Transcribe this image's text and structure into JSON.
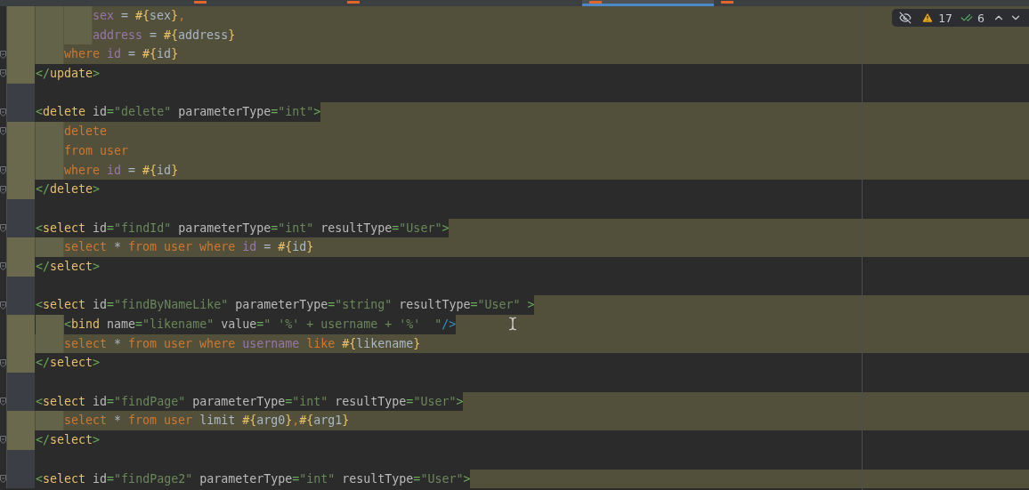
{
  "tabs": [
    {
      "selected": false
    },
    {
      "selected": false
    },
    {
      "selected": true
    },
    {
      "selected": false
    }
  ],
  "inspections": {
    "warnings": "17",
    "weak_warnings": "6"
  },
  "lines": [
    {
      "kind": "full",
      "gutter_marked": true,
      "fold_marker": false,
      "tokens": [
        {
          "kind": "ident",
          "text": "        sex"
        },
        {
          "kind": "text",
          "text": " = "
        },
        {
          "kind": "expr",
          "text": "#{"
        },
        {
          "kind": "text",
          "text": "sex"
        },
        {
          "kind": "expr",
          "text": "}"
        },
        {
          "kind": "kw",
          "text": ","
        }
      ]
    },
    {
      "kind": "full",
      "gutter_marked": true,
      "fold_marker": false,
      "tokens": [
        {
          "kind": "ident",
          "text": "        address"
        },
        {
          "kind": "text",
          "text": " = "
        },
        {
          "kind": "expr",
          "text": "#{"
        },
        {
          "kind": "text",
          "text": "address"
        },
        {
          "kind": "expr",
          "text": "}"
        }
      ]
    },
    {
      "kind": "full",
      "gutter_marked": true,
      "fold_marker": true,
      "tokens": [
        {
          "kind": "kw",
          "text": "    where "
        },
        {
          "kind": "ident",
          "text": "id"
        },
        {
          "kind": "text",
          "text": " = "
        },
        {
          "kind": "expr",
          "text": "#{"
        },
        {
          "kind": "text",
          "text": "id"
        },
        {
          "kind": "expr",
          "text": "}"
        }
      ]
    },
    {
      "kind": "plain",
      "gutter_marked": true,
      "fold_marker": true,
      "tokens": [
        {
          "kind": "bracket",
          "text": "</"
        },
        {
          "kind": "tag",
          "text": "update"
        },
        {
          "kind": "bracket",
          "text": ">"
        }
      ]
    },
    {
      "kind": "plain",
      "gutter_marked": false,
      "fold_marker": false
    },
    {
      "kind": "tail",
      "gutter_marked": false,
      "fold_marker": true,
      "tokens": [
        {
          "kind": "bracket",
          "text": "<"
        },
        {
          "kind": "tag",
          "text": "delete"
        },
        {
          "kind": "attr",
          "text": " id"
        },
        {
          "kind": "eq",
          "text": "="
        },
        {
          "kind": "str",
          "text": "\"delete\""
        },
        {
          "kind": "attr",
          "text": " parameterType"
        },
        {
          "kind": "eq",
          "text": "="
        },
        {
          "kind": "str",
          "text": "\"int\""
        },
        {
          "kind": "bracket",
          "text": ">"
        }
      ]
    },
    {
      "kind": "full",
      "gutter_marked": true,
      "fold_marker": true,
      "tokens": [
        {
          "kind": "kw",
          "text": "    delete"
        }
      ]
    },
    {
      "kind": "full",
      "gutter_marked": true,
      "fold_marker": false,
      "tokens": [
        {
          "kind": "kw",
          "text": "    from user"
        }
      ]
    },
    {
      "kind": "full",
      "gutter_marked": true,
      "fold_marker": true,
      "tokens": [
        {
          "kind": "kw",
          "text": "    where "
        },
        {
          "kind": "ident",
          "text": "id"
        },
        {
          "kind": "text",
          "text": " = "
        },
        {
          "kind": "expr",
          "text": "#{"
        },
        {
          "kind": "text",
          "text": "id"
        },
        {
          "kind": "expr",
          "text": "}"
        }
      ]
    },
    {
      "kind": "plain",
      "gutter_marked": true,
      "fold_marker": true,
      "tokens": [
        {
          "kind": "bracket",
          "text": "</"
        },
        {
          "kind": "tag",
          "text": "delete"
        },
        {
          "kind": "bracket",
          "text": ">"
        }
      ]
    },
    {
      "kind": "plain",
      "gutter_marked": false,
      "fold_marker": false
    },
    {
      "kind": "tail",
      "gutter_marked": false,
      "fold_marker": true,
      "tokens": [
        {
          "kind": "bracket",
          "text": "<"
        },
        {
          "kind": "tag",
          "text": "select"
        },
        {
          "kind": "attr",
          "text": " id"
        },
        {
          "kind": "eq",
          "text": "="
        },
        {
          "kind": "str",
          "text": "\"findId\""
        },
        {
          "kind": "attr",
          "text": " parameterType"
        },
        {
          "kind": "eq",
          "text": "="
        },
        {
          "kind": "str",
          "text": "\"int\""
        },
        {
          "kind": "attr",
          "text": " resultType"
        },
        {
          "kind": "eq",
          "text": "="
        },
        {
          "kind": "str",
          "text": "\"User\""
        },
        {
          "kind": "bracket",
          "text": ">"
        }
      ]
    },
    {
      "kind": "full",
      "gutter_marked": true,
      "fold_marker": false,
      "tokens": [
        {
          "kind": "kw",
          "text": "    select "
        },
        {
          "kind": "text",
          "text": "* "
        },
        {
          "kind": "kw",
          "text": "from user where "
        },
        {
          "kind": "ident",
          "text": "id"
        },
        {
          "kind": "text",
          "text": " = "
        },
        {
          "kind": "expr",
          "text": "#{"
        },
        {
          "kind": "text",
          "text": "id"
        },
        {
          "kind": "expr",
          "text": "}"
        }
      ]
    },
    {
      "kind": "plain",
      "gutter_marked": true,
      "fold_marker": true,
      "tokens": [
        {
          "kind": "bracket",
          "text": "</"
        },
        {
          "kind": "tag",
          "text": "select"
        },
        {
          "kind": "bracket",
          "text": ">"
        }
      ]
    },
    {
      "kind": "plain",
      "gutter_marked": false,
      "fold_marker": false
    },
    {
      "kind": "tail",
      "gutter_marked": false,
      "fold_marker": true,
      "tokens": [
        {
          "kind": "bracket",
          "text": "<"
        },
        {
          "kind": "tag",
          "text": "select"
        },
        {
          "kind": "attr",
          "text": " id"
        },
        {
          "kind": "eq",
          "text": "="
        },
        {
          "kind": "str",
          "text": "\"findByNameLike\""
        },
        {
          "kind": "attr",
          "text": " parameterType"
        },
        {
          "kind": "eq",
          "text": "="
        },
        {
          "kind": "str",
          "text": "\"string\""
        },
        {
          "kind": "attr",
          "text": " resultType"
        },
        {
          "kind": "eq",
          "text": "="
        },
        {
          "kind": "str",
          "text": "\"User\""
        },
        {
          "kind": "bracket",
          "text": " >"
        }
      ]
    },
    {
      "kind": "tail",
      "gutter_marked": true,
      "fold_marker": false,
      "tokens": [
        {
          "kind": "bracket",
          "text": "    <"
        },
        {
          "kind": "tag",
          "text": "bind"
        },
        {
          "kind": "attr",
          "text": " name"
        },
        {
          "kind": "eq",
          "text": "="
        },
        {
          "kind": "str",
          "text": "\"likename\""
        },
        {
          "kind": "attr",
          "text": " value"
        },
        {
          "kind": "eq",
          "text": "="
        },
        {
          "kind": "str",
          "text": "\" '%' + username + '%'  \""
        },
        {
          "kind": "close",
          "text": "/>"
        }
      ]
    },
    {
      "kind": "full",
      "gutter_marked": true,
      "fold_marker": false,
      "tokens": [
        {
          "kind": "kw",
          "text": "    select "
        },
        {
          "kind": "text",
          "text": "* "
        },
        {
          "kind": "kw",
          "text": "from user where "
        },
        {
          "kind": "ident",
          "text": "username"
        },
        {
          "kind": "kw",
          "text": " like "
        },
        {
          "kind": "expr",
          "text": "#{"
        },
        {
          "kind": "text",
          "text": "likename"
        },
        {
          "kind": "expr",
          "text": "}"
        }
      ]
    },
    {
      "kind": "plain",
      "gutter_marked": true,
      "fold_marker": true,
      "tokens": [
        {
          "kind": "bracket",
          "text": "</"
        },
        {
          "kind": "tag",
          "text": "select"
        },
        {
          "kind": "bracket",
          "text": ">"
        }
      ]
    },
    {
      "kind": "plain",
      "gutter_marked": false,
      "fold_marker": false
    },
    {
      "kind": "tail",
      "gutter_marked": false,
      "fold_marker": true,
      "tokens": [
        {
          "kind": "bracket",
          "text": "<"
        },
        {
          "kind": "tag",
          "text": "select"
        },
        {
          "kind": "attr",
          "text": " id"
        },
        {
          "kind": "eq",
          "text": "="
        },
        {
          "kind": "str",
          "text": "\"findPage\""
        },
        {
          "kind": "attr",
          "text": " parameterType"
        },
        {
          "kind": "eq",
          "text": "="
        },
        {
          "kind": "str",
          "text": "\"int\""
        },
        {
          "kind": "attr",
          "text": " resultType"
        },
        {
          "kind": "eq",
          "text": "="
        },
        {
          "kind": "str",
          "text": "\"User\""
        },
        {
          "kind": "bracket",
          "text": ">"
        }
      ]
    },
    {
      "kind": "full",
      "gutter_marked": true,
      "fold_marker": false,
      "tokens": [
        {
          "kind": "kw",
          "text": "    select "
        },
        {
          "kind": "text",
          "text": "* "
        },
        {
          "kind": "kw",
          "text": "from user "
        },
        {
          "kind": "text",
          "text": "limit "
        },
        {
          "kind": "expr",
          "text": "#{"
        },
        {
          "kind": "text",
          "text": "arg0"
        },
        {
          "kind": "expr",
          "text": "}"
        },
        {
          "kind": "kw",
          "text": ","
        },
        {
          "kind": "expr",
          "text": "#{"
        },
        {
          "kind": "text",
          "text": "arg1"
        },
        {
          "kind": "expr",
          "text": "}"
        }
      ]
    },
    {
      "kind": "plain",
      "gutter_marked": true,
      "fold_marker": true,
      "tokens": [
        {
          "kind": "bracket",
          "text": "</"
        },
        {
          "kind": "tag",
          "text": "select"
        },
        {
          "kind": "bracket",
          "text": ">"
        }
      ]
    },
    {
      "kind": "plain",
      "gutter_marked": false,
      "fold_marker": false
    },
    {
      "kind": "tail",
      "gutter_marked": false,
      "fold_marker": true,
      "tokens": [
        {
          "kind": "bracket",
          "text": "<"
        },
        {
          "kind": "tag",
          "text": "select"
        },
        {
          "kind": "attr",
          "text": " id"
        },
        {
          "kind": "eq",
          "text": "="
        },
        {
          "kind": "str",
          "text": "\"findPage2\""
        },
        {
          "kind": "attr",
          "text": " parameterType"
        },
        {
          "kind": "eq",
          "text": "="
        },
        {
          "kind": "str",
          "text": "\"int\""
        },
        {
          "kind": "attr",
          "text": " resultType"
        },
        {
          "kind": "eq",
          "text": "="
        },
        {
          "kind": "str",
          "text": "\"User\""
        },
        {
          "kind": "bracket",
          "text": ">"
        }
      ]
    }
  ]
}
